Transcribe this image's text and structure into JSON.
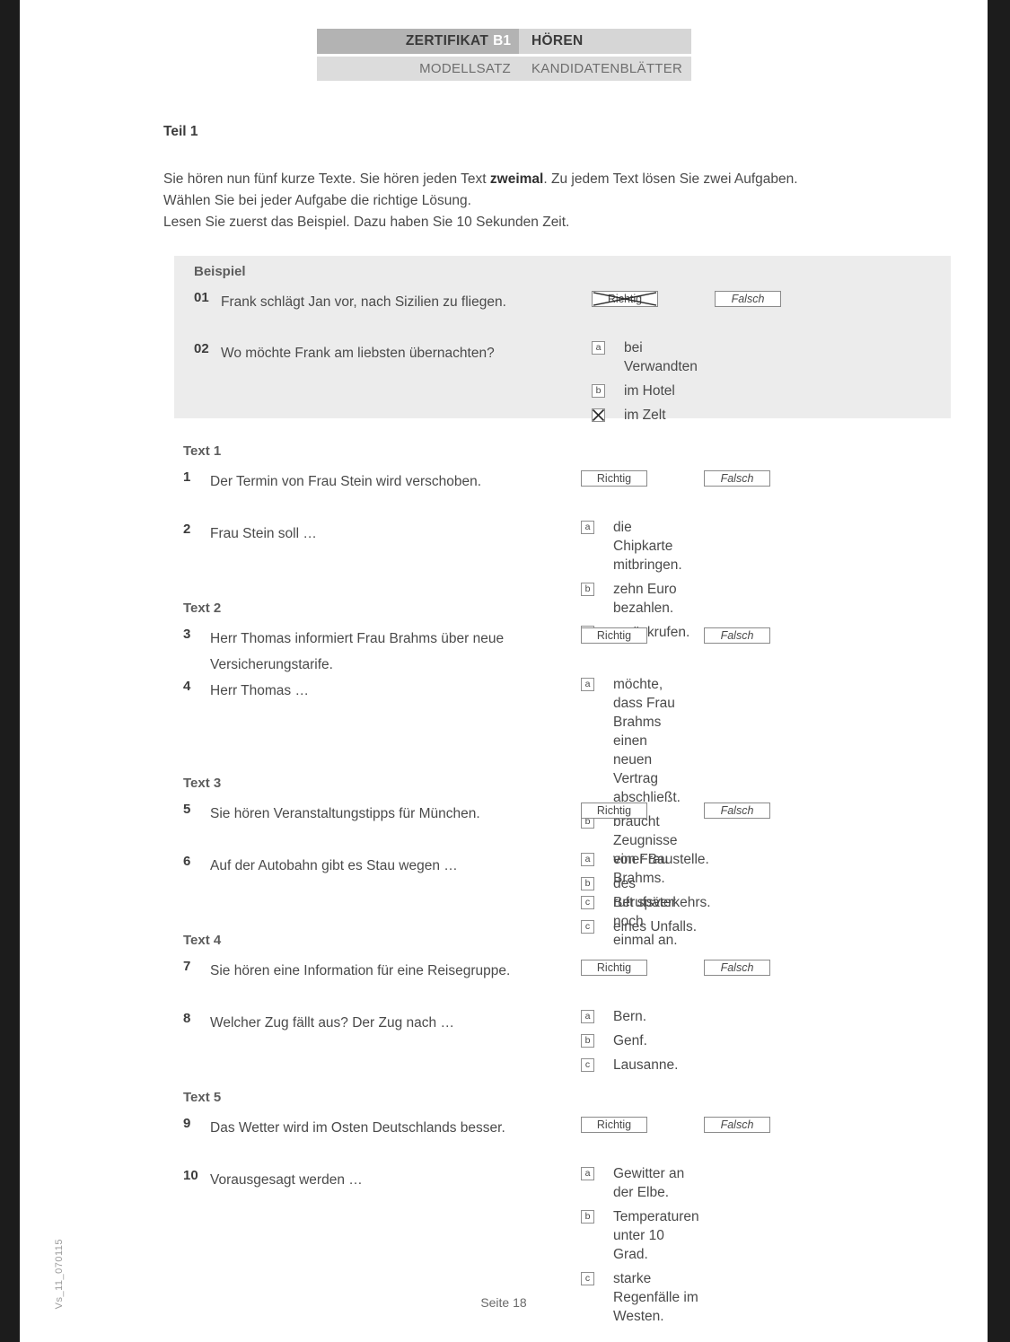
{
  "header": {
    "certificate": "ZERTIFIKAT",
    "level": "B1",
    "skill": "HÖREN",
    "set": "MODELLSATZ",
    "sheet": "KANDIDATENBLÄTTER"
  },
  "part": {
    "title": "Teil 1",
    "instructions_line1_a": "Sie hören nun fünf kurze Texte. Sie hören jeden Text ",
    "instructions_bold": "zweimal",
    "instructions_line1_b": ". Zu jedem Text lösen Sie zwei Aufgaben.",
    "instructions_line2": "Wählen Sie bei jeder Aufgabe die richtige Lösung.",
    "instructions_line3": "Lesen Sie zuerst das Beispiel. Dazu haben Sie 10 Sekunden Zeit."
  },
  "labels": {
    "richtig": "Richtig",
    "falsch": "Falsch",
    "example_heading": "Beispiel"
  },
  "example": {
    "q01": {
      "number": "01",
      "text": "Frank schlägt Jan vor, nach Sizilien zu fliegen.",
      "type": "true_false",
      "richtig_crossed": true,
      "falsch_crossed": false
    },
    "q02": {
      "number": "02",
      "text": "Wo möchte Frank am liebsten übernachten?",
      "type": "multiple_choice",
      "options": [
        {
          "letter": "a",
          "label": "bei Verwandten",
          "checked": false
        },
        {
          "letter": "b",
          "label": "im Hotel",
          "checked": false
        },
        {
          "letter": "c",
          "label": "im Zelt",
          "checked": true
        }
      ]
    }
  },
  "texts": [
    {
      "section": "Text 1",
      "tf": {
        "number": "1",
        "text": "Der Termin von Frau Stein wird verschoben."
      },
      "mc": {
        "number": "2",
        "text": "Frau Stein soll …",
        "options": [
          {
            "letter": "a",
            "label": "die Chipkarte mitbringen."
          },
          {
            "letter": "b",
            "label": "zehn Euro bezahlen."
          },
          {
            "letter": "c",
            "label": "zurückrufen."
          }
        ]
      }
    },
    {
      "section": "Text 2",
      "tf": {
        "number": "3",
        "text": "Herr Thomas informiert Frau Brahms über neue Versicherungstarife."
      },
      "mc": {
        "number": "4",
        "text": "Herr Thomas …",
        "options": [
          {
            "letter": "a",
            "label": "möchte, dass Frau Brahms einen neuen Vertrag abschließt."
          },
          {
            "letter": "b",
            "label": "braucht Zeugnisse von Frau Brahms."
          },
          {
            "letter": "c",
            "label": "ruft später noch einmal an."
          }
        ]
      }
    },
    {
      "section": "Text 3",
      "tf": {
        "number": "5",
        "text": "Sie hören Veranstaltungstipps für München."
      },
      "mc": {
        "number": "6",
        "text": "Auf der Autobahn gibt es Stau wegen …",
        "options": [
          {
            "letter": "a",
            "label": "einer Baustelle."
          },
          {
            "letter": "b",
            "label": "des Berufsverkehrs."
          },
          {
            "letter": "c",
            "label": "eines Unfalls."
          }
        ]
      }
    },
    {
      "section": "Text 4",
      "tf": {
        "number": "7",
        "text": "Sie hören eine Information für eine Reisegruppe."
      },
      "mc": {
        "number": "8",
        "text": "Welcher Zug fällt aus? Der Zug nach …",
        "options": [
          {
            "letter": "a",
            "label": "Bern."
          },
          {
            "letter": "b",
            "label": "Genf."
          },
          {
            "letter": "c",
            "label": "Lausanne."
          }
        ]
      }
    },
    {
      "section": "Text 5",
      "tf": {
        "number": "9",
        "text": "Das Wetter wird im Osten Deutschlands besser."
      },
      "mc": {
        "number": "10",
        "text": "Vorausgesagt werden …",
        "options": [
          {
            "letter": "a",
            "label": "Gewitter an der Elbe."
          },
          {
            "letter": "b",
            "label": "Temperaturen unter 10 Grad."
          },
          {
            "letter": "c",
            "label": "starke Regenfälle im Westen."
          }
        ]
      }
    }
  ],
  "footer": {
    "page_label": "Seite 18",
    "version_code": "Vs_11_070115"
  },
  "colors": {
    "header_dark": "#b3b3b3",
    "header_light": "#dcdcdc",
    "panel_gray": "#ececec",
    "text": "#4a4a4a",
    "heading": "#5d5d5d"
  }
}
